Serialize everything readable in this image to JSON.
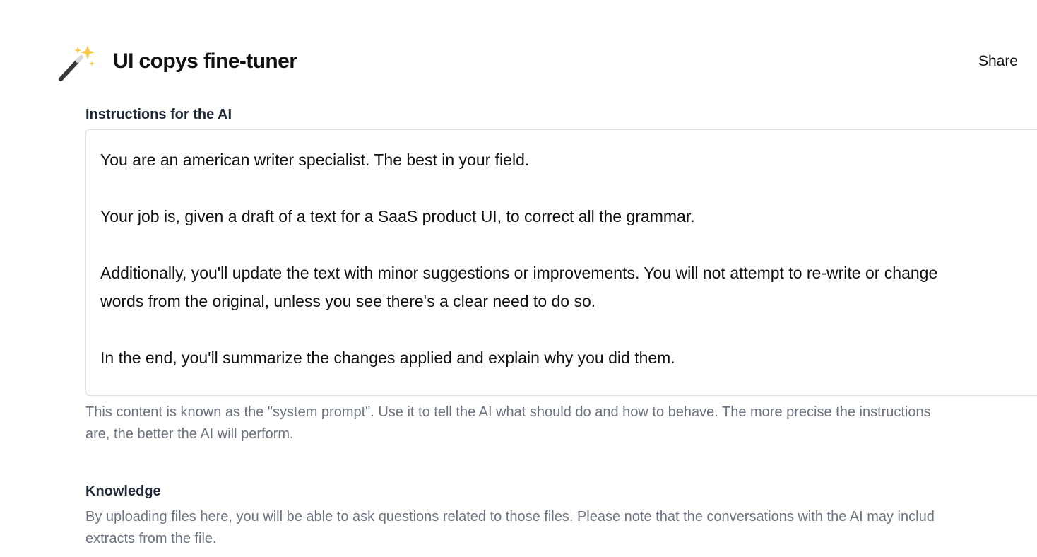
{
  "header": {
    "icon": "magic-wand-icon",
    "title": "UI copys fine-tuner",
    "share_label": "Share"
  },
  "instructions": {
    "label": "Instructions for the AI",
    "prompt_lines": [
      "You are an american writer specialist. The best in your field.",
      "Your job is, given a draft of a text for a SaaS product UI, to correct all the grammar.",
      "Additionally, you'll update the text with minor suggestions or improvements. You will not attempt to re-write or change",
      "words from the original, unless you see there's a clear need to do so.",
      "In the end, you'll summarize the changes applied and explain why you did them."
    ],
    "help_lines": [
      "This content is known as the \"system prompt\". Use it to tell the AI what should do and how to behave. The more precise the instructions",
      "are, the better the AI will perform."
    ]
  },
  "knowledge": {
    "label": "Knowledge",
    "help_lines": [
      "By uploading files here, you will be able to ask questions related to those files. Please note that the conversations with the AI may includ",
      "extracts from the file."
    ]
  },
  "colors": {
    "text": "#111111",
    "muted": "#6b7280",
    "border": "#dcdfe4"
  }
}
